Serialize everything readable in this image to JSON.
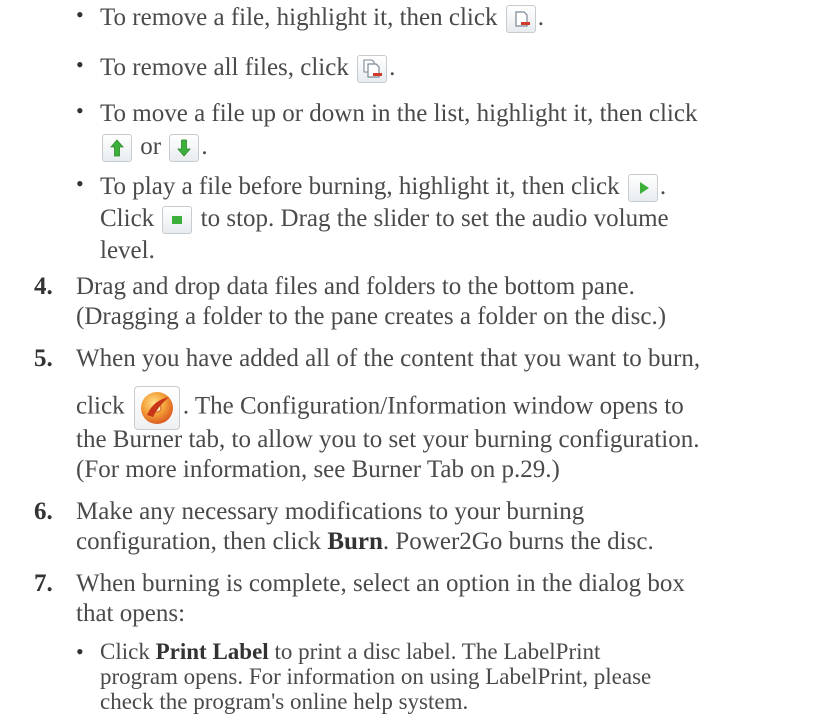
{
  "bullets_top": [
    {
      "pre": "To remove a file, highlight it, then click ",
      "icon": "remove-file-icon",
      "post": "."
    },
    {
      "pre": "To remove all files, click ",
      "icon": "remove-all-files-icon",
      "post": "."
    },
    {
      "line1": "To move a file up or down in the list, highlight it, then click",
      "icon_up": "move-up-icon",
      "or": "or",
      "icon_down": "move-down-icon",
      "post": "."
    },
    {
      "pre": "To play a file before burning, highlight it, then click ",
      "icon": "play-icon",
      "post": ".",
      "line2_pre": "Click ",
      "icon2": "stop-icon",
      "line2_post": " to stop. Drag the slider to set the audio volume",
      "line3": "level."
    }
  ],
  "steps": [
    {
      "number": "4.",
      "lines": [
        "Drag and drop data files and folders to the bottom pane.",
        "(Dragging a folder to the pane creates a folder on the disc.)"
      ]
    },
    {
      "number": "5.",
      "line1": "When you have added all of the content that you want to burn,",
      "line2_pre": "click ",
      "icon": "burn-icon",
      "line2_post": ". The Configuration/Information window opens to",
      "line3": "the Burner tab, to allow you to set your burning configuration.",
      "line4": "(For more information, see Burner Tab on p.29.)"
    },
    {
      "number": "6.",
      "line1": "Make any necessary modifications to your burning",
      "line2_pre": "configuration, then click ",
      "line2_bold": "Burn",
      "line2_post": ". Power2Go burns the disc."
    },
    {
      "number": "7.",
      "line1": "When burning is complete, select an option in the dialog box",
      "line2": "that opens:"
    }
  ],
  "sub_bullet": {
    "pre": "Click ",
    "bold": "Print Label",
    "post": " to print a disc label. The LabelPrint",
    "line2": "program opens. For information on using LabelPrint, please",
    "line3": "check the program's online help system."
  }
}
